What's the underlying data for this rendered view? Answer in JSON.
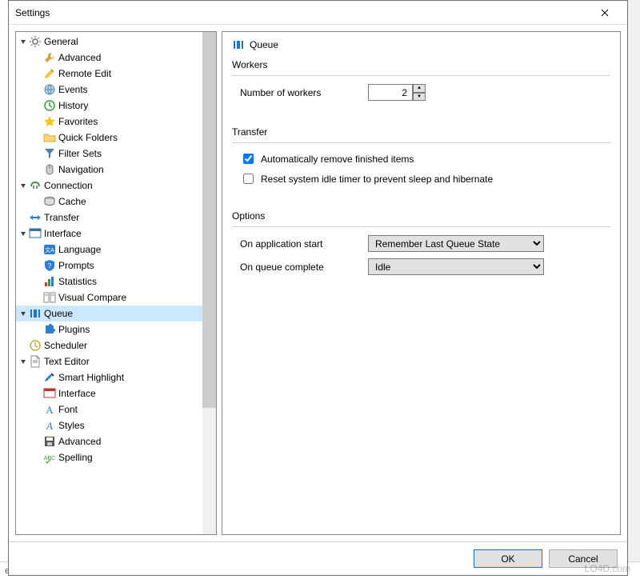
{
  "window": {
    "title": "Settings"
  },
  "tree": [
    {
      "label": "General",
      "icon": "gear",
      "indent": 0,
      "exp": "open"
    },
    {
      "label": "Advanced",
      "icon": "wrench",
      "indent": 1
    },
    {
      "label": "Remote Edit",
      "icon": "pencil",
      "indent": 1
    },
    {
      "label": "Events",
      "icon": "globe",
      "indent": 1
    },
    {
      "label": "History",
      "icon": "clock-green",
      "indent": 1
    },
    {
      "label": "Favorites",
      "icon": "star",
      "indent": 1
    },
    {
      "label": "Quick Folders",
      "icon": "folder",
      "indent": 1
    },
    {
      "label": "Filter Sets",
      "icon": "funnel",
      "indent": 1
    },
    {
      "label": "Navigation",
      "icon": "mouse",
      "indent": 1
    },
    {
      "label": "Connection",
      "icon": "plug",
      "indent": 0,
      "exp": "open"
    },
    {
      "label": "Cache",
      "icon": "disk",
      "indent": 1
    },
    {
      "label": "Transfer",
      "icon": "arrows-h",
      "indent": 0
    },
    {
      "label": "Interface",
      "icon": "window-blue",
      "indent": 0,
      "exp": "open"
    },
    {
      "label": "Language",
      "icon": "lang",
      "indent": 1
    },
    {
      "label": "Prompts",
      "icon": "shield-q",
      "indent": 1
    },
    {
      "label": "Statistics",
      "icon": "chart",
      "indent": 1
    },
    {
      "label": "Visual Compare",
      "icon": "compare",
      "indent": 1
    },
    {
      "label": "Queue",
      "icon": "queue",
      "indent": 0,
      "exp": "open",
      "selected": true
    },
    {
      "label": "Plugins",
      "icon": "puzzle",
      "indent": 1
    },
    {
      "label": "Scheduler",
      "icon": "clock",
      "indent": 0
    },
    {
      "label": "Text Editor",
      "icon": "doc",
      "indent": 0,
      "exp": "open"
    },
    {
      "label": "Smart Highlight",
      "icon": "highlighter",
      "indent": 1
    },
    {
      "label": "Interface",
      "icon": "window-red",
      "indent": 1
    },
    {
      "label": "Font",
      "icon": "font-a",
      "indent": 1
    },
    {
      "label": "Styles",
      "icon": "styles-a",
      "indent": 1
    },
    {
      "label": "Advanced",
      "icon": "save",
      "indent": 1
    },
    {
      "label": "Spelling",
      "icon": "abc",
      "indent": 1
    }
  ],
  "content": {
    "title": "Queue",
    "workers": {
      "group_label": "Workers",
      "number_label": "Number of workers",
      "number_value": "2"
    },
    "transfer": {
      "group_label": "Transfer",
      "auto_remove_label": "Automatically remove finished items",
      "auto_remove_checked": true,
      "reset_idle_label": "Reset system idle timer to prevent sleep and hibernate",
      "reset_idle_checked": false
    },
    "options": {
      "group_label": "Options",
      "on_start_label": "On application start",
      "on_start_value": "Remember Last Queue State",
      "on_complete_label": "On queue complete",
      "on_complete_value": "Idle"
    }
  },
  "footer": {
    "ok": "OK",
    "cancel": "Cancel"
  },
  "background": {
    "status_text": "esti...  Status"
  },
  "watermark": "LO4D.com"
}
